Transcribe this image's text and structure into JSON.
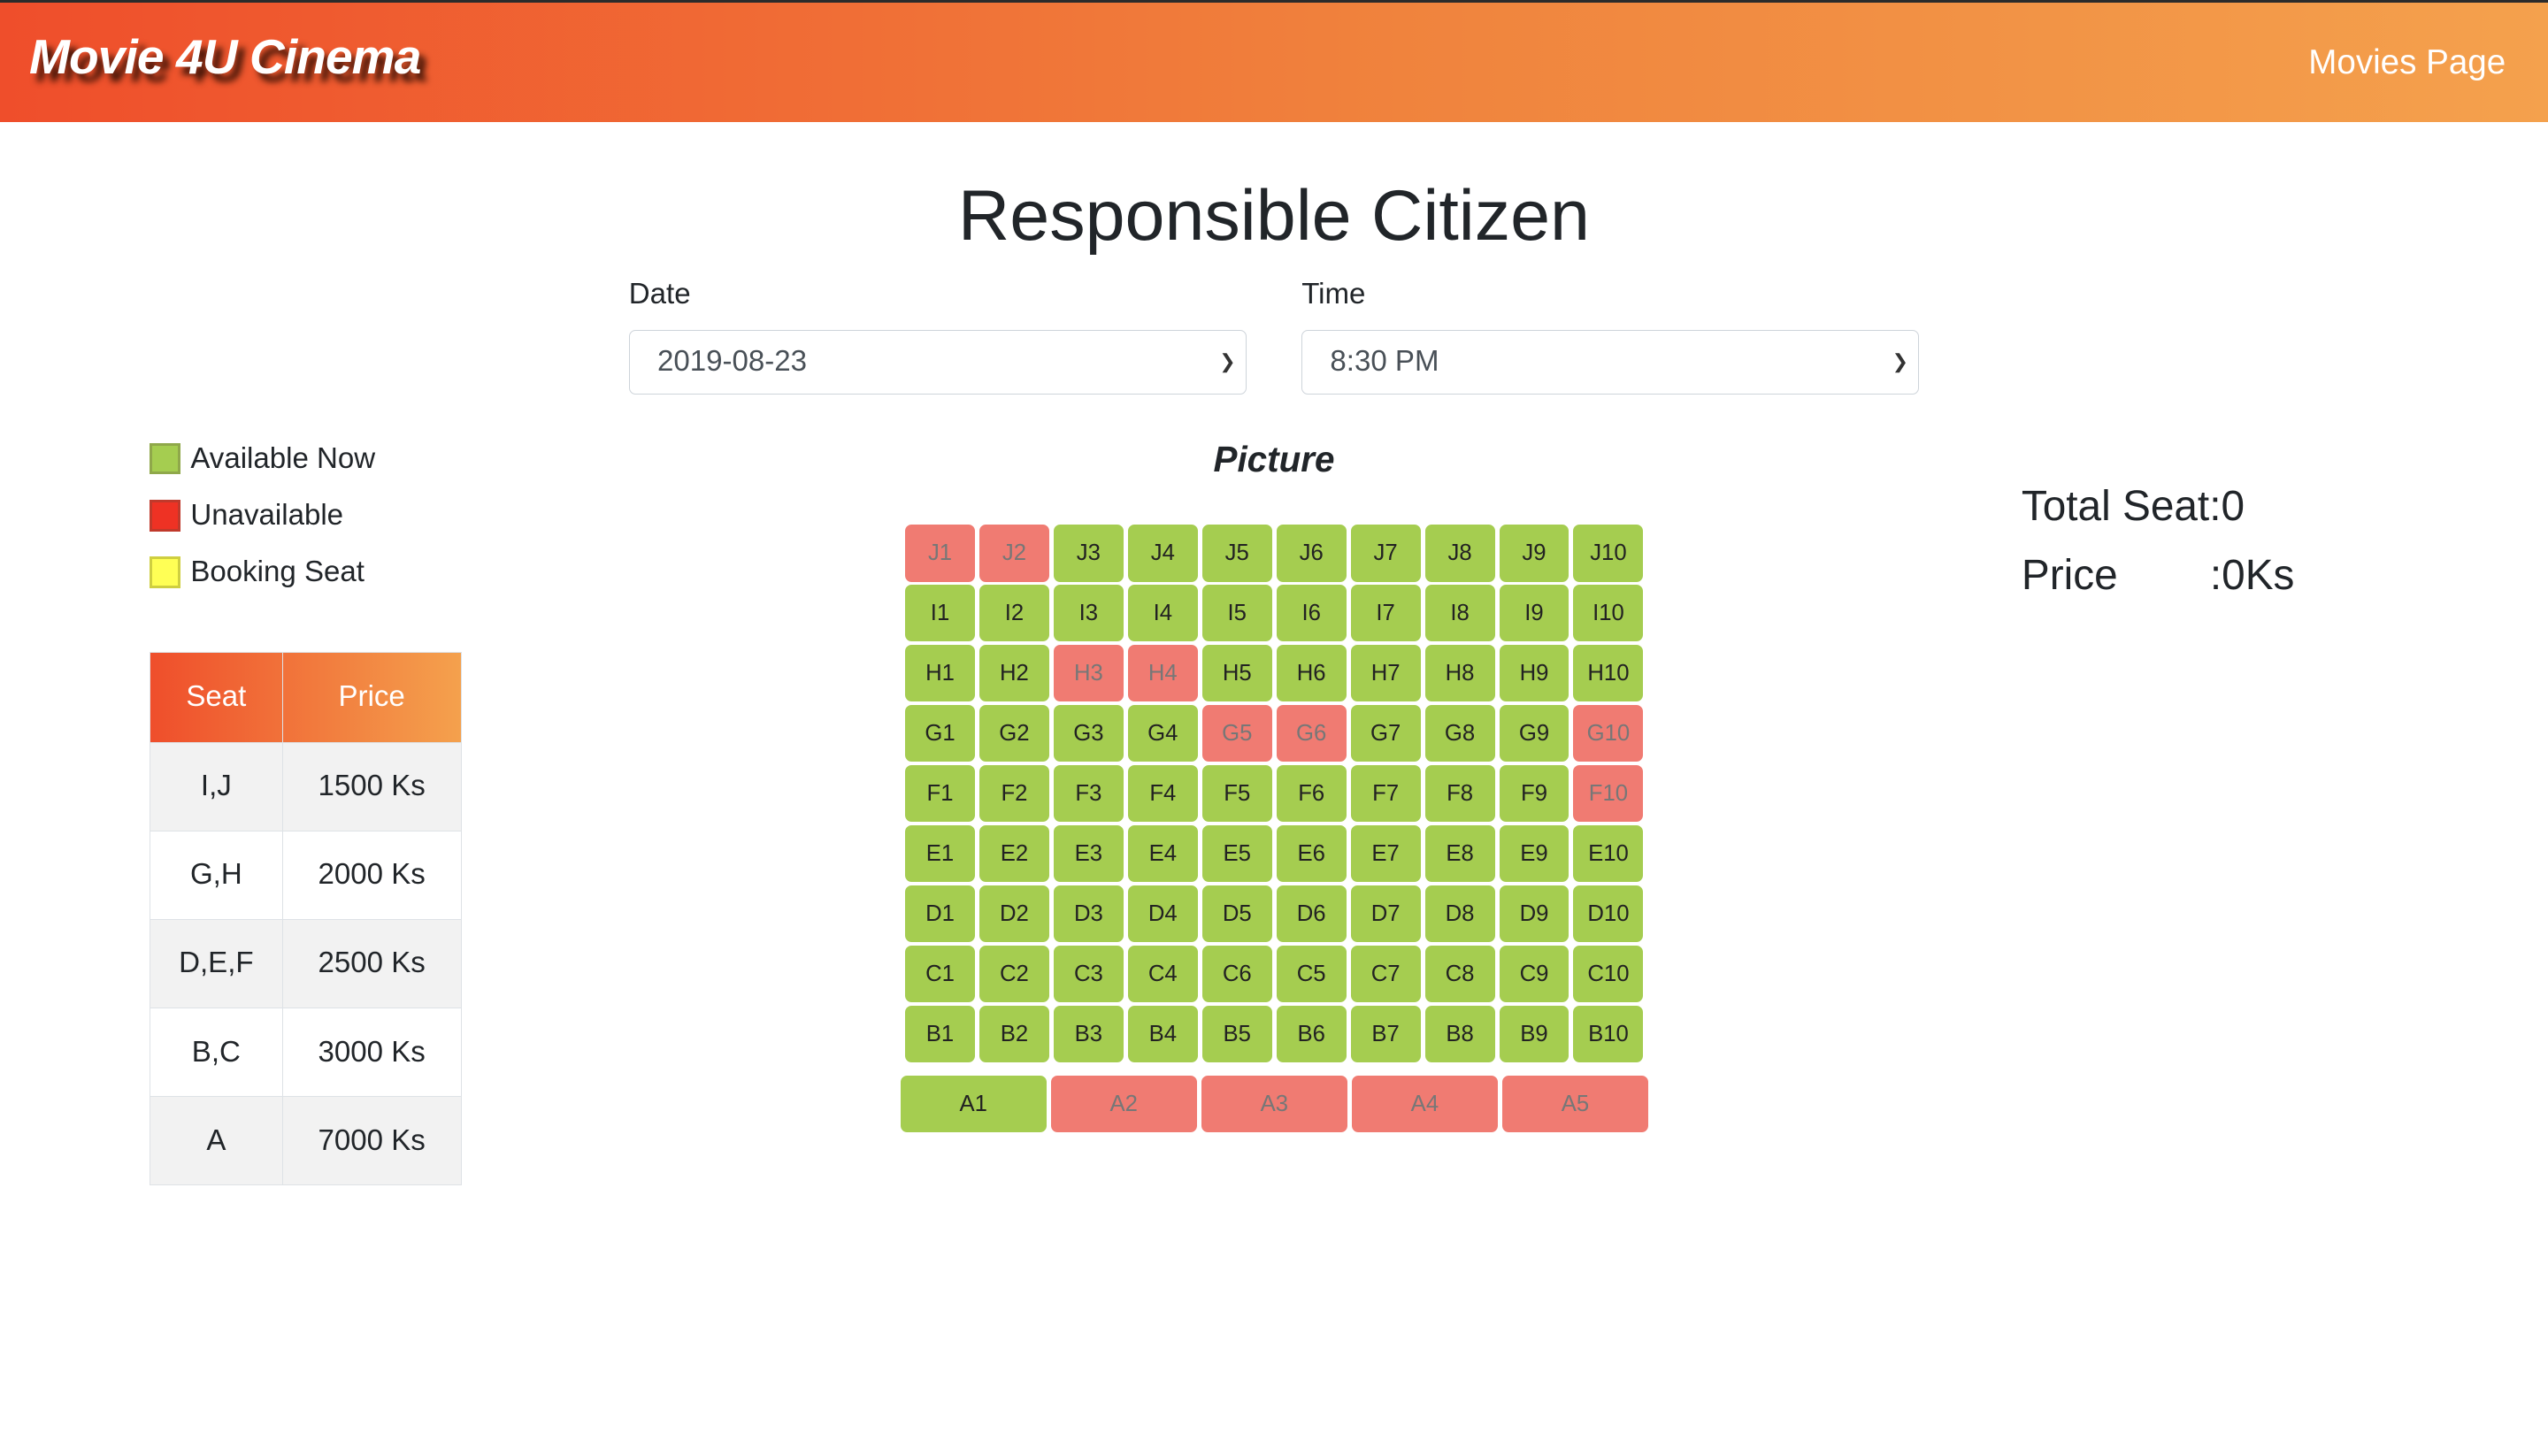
{
  "header": {
    "brand": "Movie 4U Cinema",
    "nav_link": "Movies Page"
  },
  "movie_title": "Responsible Citizen",
  "date": {
    "label": "Date",
    "value": "2019-08-23"
  },
  "time": {
    "label": "Time",
    "value": "8:30 PM"
  },
  "legend": [
    {
      "label": "Available Now",
      "color": "#a5cd50"
    },
    {
      "label": "Unavailable",
      "color": "#ee3224"
    },
    {
      "label": "Booking Seat",
      "color": "#ffff55"
    }
  ],
  "price_table": {
    "headers": [
      "Seat",
      "Price"
    ],
    "rows": [
      [
        "I,J",
        "1500 Ks"
      ],
      [
        "G,H",
        "2000 Ks"
      ],
      [
        "D,E,F",
        "2500 Ks"
      ],
      [
        "B,C",
        "3000 Ks"
      ],
      [
        "A",
        "7000 Ks"
      ]
    ]
  },
  "screen_label": "Picture",
  "seat_colors": {
    "available": "#a5cd50",
    "unavailable": "#f07b72"
  },
  "seat_rows": [
    [
      "J1:u",
      "J2:u",
      "J3",
      "J4",
      "J5",
      "J6",
      "J7",
      "J8",
      "J9",
      "J10"
    ],
    [
      "I1",
      "I2",
      "I3",
      "I4",
      "I5",
      "I6",
      "I7",
      "I8",
      "I9",
      "I10"
    ],
    [
      "H1",
      "H2",
      "H3:u",
      "H4:u",
      "H5",
      "H6",
      "H7",
      "H8",
      "H9",
      "H10"
    ],
    [
      "G1",
      "G2",
      "G3",
      "G4",
      "G5:u",
      "G6:u",
      "G7",
      "G8",
      "G9",
      "G10:u"
    ],
    [
      "F1",
      "F2",
      "F3",
      "F4",
      "F5",
      "F6",
      "F7",
      "F8",
      "F9",
      "F10:u"
    ],
    [
      "E1",
      "E2",
      "E3",
      "E4",
      "E5",
      "E6",
      "E7",
      "E8",
      "E9",
      "E10"
    ],
    [
      "D1",
      "D2",
      "D3",
      "D4",
      "D5",
      "D6",
      "D7",
      "D8",
      "D9",
      "D10"
    ],
    [
      "C1",
      "C2",
      "C3",
      "C4",
      "C6",
      "C5",
      "C7",
      "C8",
      "C9",
      "C10"
    ],
    [
      "B1",
      "B2",
      "B3",
      "B4",
      "B5",
      "B6",
      "B7",
      "B8",
      "B9",
      "B10"
    ],
    [
      "A1",
      "A2:u",
      "A3:u",
      "A4:u",
      "A5:u"
    ]
  ],
  "summary": {
    "total_seat": "Total Seat:0",
    "price_label": "Price",
    "price_value": ":0Ks"
  }
}
